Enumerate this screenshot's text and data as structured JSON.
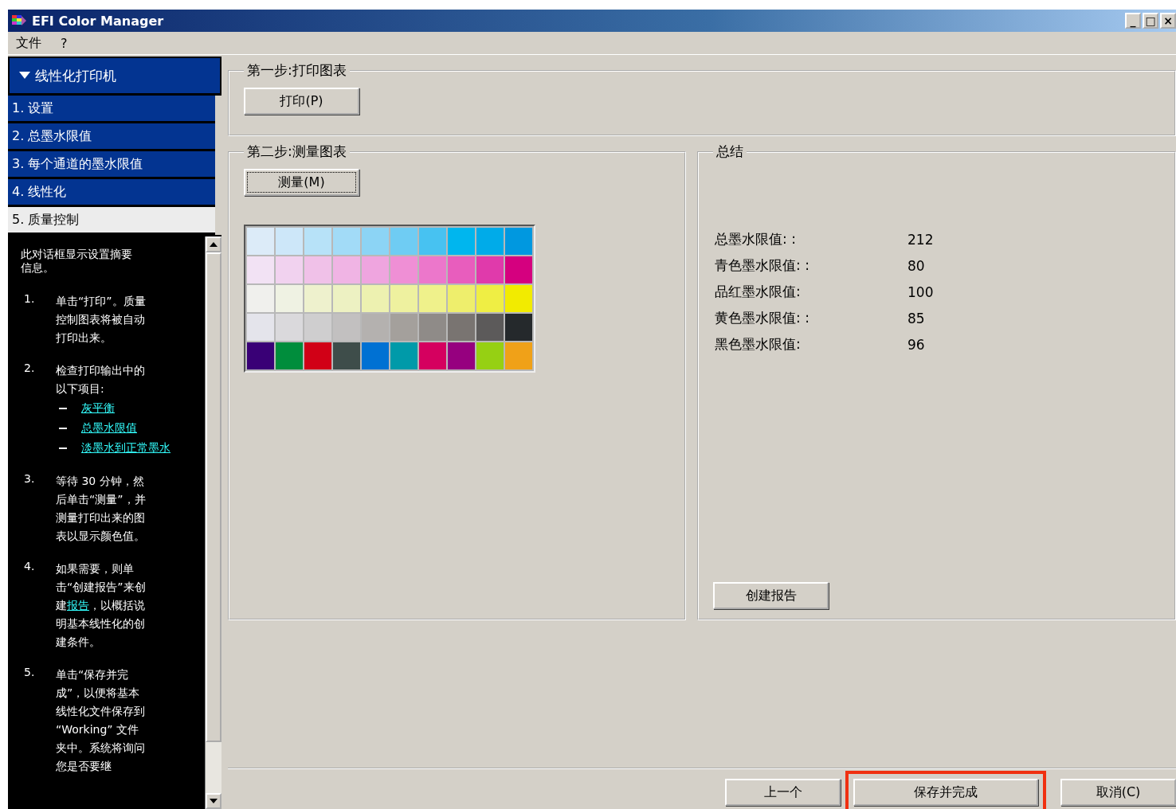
{
  "window": {
    "title": "EFI Color Manager",
    "controls": [
      "_",
      "□",
      "×"
    ]
  },
  "menu": [
    "文件",
    "?"
  ],
  "sidebar": {
    "header": "线性化打印机",
    "expanded": true,
    "items": [
      {
        "label": "1. 设置",
        "selected": false
      },
      {
        "label": "2. 总墨水限值",
        "selected": false
      },
      {
        "label": "3. 每个通道的墨水限值",
        "selected": false
      },
      {
        "label": "4. 线性化",
        "selected": false
      },
      {
        "label": "5. 质量控制",
        "selected": true
      }
    ]
  },
  "help": {
    "intro": "此对话框显示设置摘要信息。",
    "steps": [
      {
        "num": "1.",
        "text": "单击“打印”。质量控制图表将被自动打印出来。"
      },
      {
        "num": "2.",
        "text": "检查打印输出中的以下项目:",
        "links": [
          "灰平衡",
          "总墨水限值",
          "淡墨水到正常墨水"
        ]
      },
      {
        "num": "3.",
        "text": "等待 30 分钟，然后单击“测量”，并测量打印出来的图表以显示颜色值。"
      },
      {
        "num": "4.",
        "text": "如果需要，则单击“创建报告”来创建",
        "link": "报告",
        "text_after": "，以概括说明基本线性化的创建条件。"
      },
      {
        "num": "5.",
        "text": "单击“保存并完成”，以便将基本线性化文件保存到 “Working” 文件夹中。系统将询问您是否要继"
      }
    ]
  },
  "step1": {
    "title": "第一步:打印图表",
    "button": "打印(P)"
  },
  "step2": {
    "title": "第二步:测量图表",
    "button": "测量(M)",
    "swatches": [
      [
        {
          "color": "#dcebf8"
        },
        {
          "color": "#cde7f9"
        },
        {
          "color": "#b7e2f8"
        },
        {
          "color": "#a2dbf7"
        },
        {
          "color": "#8cd4f5"
        },
        {
          "color": "#6fccf3"
        },
        {
          "color": "#47c2f1"
        },
        {
          "color": "#00b6ee"
        },
        {
          "color": "#00abe9"
        },
        {
          "color": "#0098e0"
        }
      ],
      [
        {
          "color": "#f2e2f4"
        },
        {
          "color": "#f1d2ef"
        },
        {
          "color": "#f0c1e8"
        },
        {
          "color": "#f0b4e4"
        },
        {
          "color": "#efa5df"
        },
        {
          "color": "#ef8fd5"
        },
        {
          "color": "#ec77cb"
        },
        {
          "color": "#e85dbd"
        },
        {
          "color": "#e03aab"
        },
        {
          "color": "#d5007f"
        }
      ],
      [
        {
          "color": "#f0f0ed"
        },
        {
          "color": "#eff2e3"
        },
        {
          "color": "#eef1cd"
        },
        {
          "color": "#edf1c2"
        },
        {
          "color": "#edf1b0"
        },
        {
          "color": "#eef19f"
        },
        {
          "color": "#eff18b"
        },
        {
          "color": "#eeee6c"
        },
        {
          "color": "#efee44"
        },
        {
          "color": "#f2eb00"
        }
      ],
      [
        {
          "color": "#e4e4eb"
        },
        {
          "color": "#dad9dc"
        },
        {
          "color": "#cfcecf"
        },
        {
          "color": "#c2c0c0"
        },
        {
          "color": "#b4b1af"
        },
        {
          "color": "#a4a09c"
        },
        {
          "color": "#8f8b88"
        },
        {
          "color": "#797471"
        },
        {
          "color": "#5c5a5a"
        },
        {
          "color": "#25292c"
        }
      ],
      [
        {
          "color": "#390076"
        },
        {
          "color": "#008d3c"
        },
        {
          "color": "#d10016"
        },
        {
          "color": "#3e4d4a"
        },
        {
          "color": "#0071d3"
        },
        {
          "color": "#009aa9"
        },
        {
          "color": "#d5005f"
        },
        {
          "color": "#96007f"
        },
        {
          "color": "#96d013"
        },
        {
          "color": "#f0a118"
        }
      ]
    ]
  },
  "summary": {
    "title": "总结",
    "rows": [
      {
        "label": "总墨水限值: :",
        "value": "212"
      },
      {
        "label": "青色墨水限值: :",
        "value": "80"
      },
      {
        "label": "品红墨水限值:",
        "value": "100"
      },
      {
        "label": "黄色墨水限值: :",
        "value": "85"
      },
      {
        "label": "黑色墨水限值:",
        "value": "96"
      }
    ],
    "button": "创建报告"
  },
  "buttons": [
    {
      "label": "上一个",
      "highlighted": false
    },
    {
      "label": "保存并完成",
      "highlighted": true
    },
    {
      "label": "取消(C)",
      "highlighted": false
    }
  ]
}
